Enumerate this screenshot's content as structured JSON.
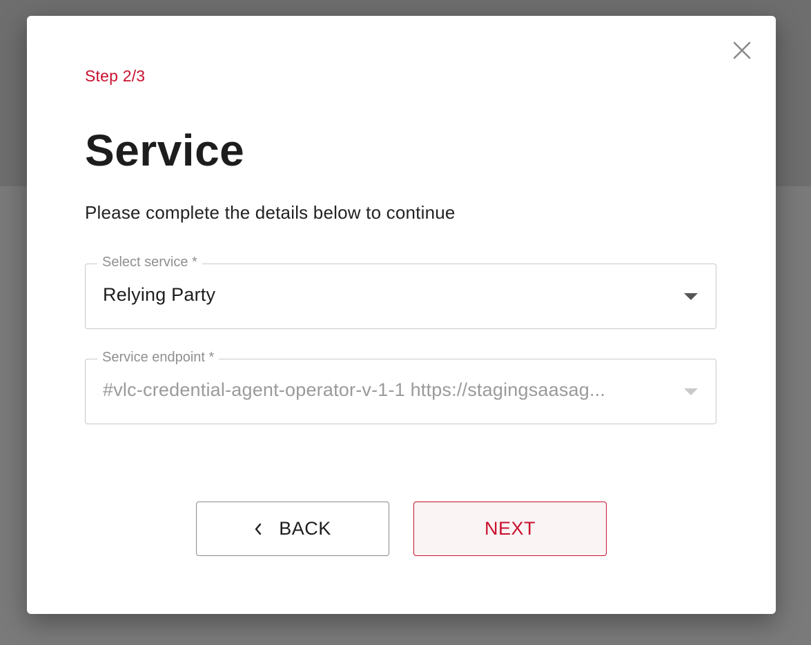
{
  "dialog": {
    "step": "Step 2/3",
    "title": "Service",
    "subtitle": "Please complete the details below to continue",
    "close_icon": "close-icon"
  },
  "fields": {
    "service": {
      "label": "Select service *",
      "value": "Relying Party"
    },
    "endpoint": {
      "label": "Service endpoint *",
      "value": "#vlc-credential-agent-operator-v-1-1 https://stagingsaasag..."
    }
  },
  "buttons": {
    "back_label": "BACK",
    "next_label": "NEXT"
  },
  "colors": {
    "accent": "#c8102e",
    "overlay": "#7a7a7a"
  }
}
